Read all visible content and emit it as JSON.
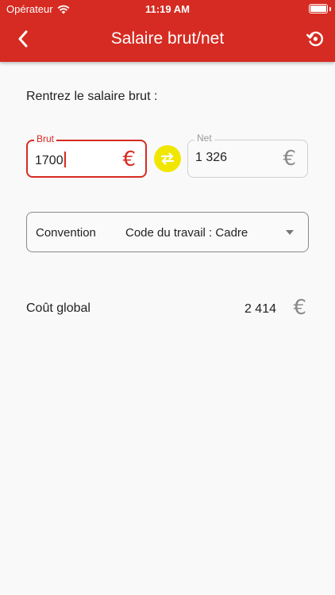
{
  "status_bar": {
    "carrier": "Opérateur",
    "time": "11:19 AM"
  },
  "nav": {
    "title": "Salaire brut/net",
    "back_icon": "chevron-left-icon",
    "reset_icon": "history-reset-icon"
  },
  "form": {
    "prompt": "Rentrez le salaire brut :",
    "brut": {
      "label": "Brut",
      "value": "1700",
      "currency": "€"
    },
    "net": {
      "label": "Net",
      "value": "1 326",
      "currency": "€"
    },
    "swap_icon": "swap-arrows-icon",
    "convention": {
      "label": "Convention",
      "value": "Code du travail : Cadre"
    }
  },
  "total": {
    "label": "Coût global",
    "value": "2 414",
    "currency": "€"
  },
  "colors": {
    "primary": "#d62b22",
    "swap_button": "#f0e600",
    "background": "#f9f9f9"
  }
}
